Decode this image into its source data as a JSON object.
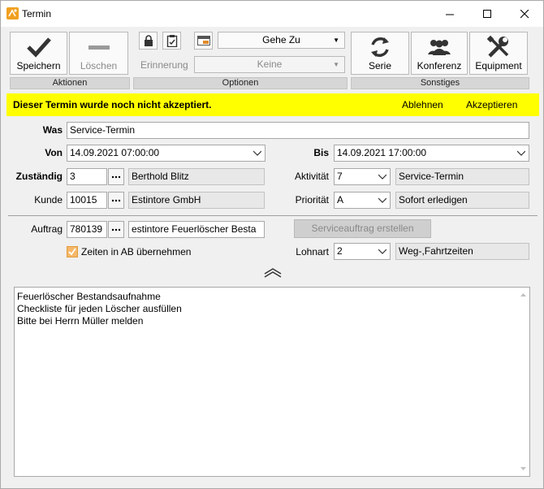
{
  "window": {
    "title": "Termin"
  },
  "toolbar": {
    "save_label": "Speichern",
    "delete_label": "Löschen",
    "goto_label": "Gehe Zu",
    "reminder_label": "Erinnerung",
    "reminder_value": "Keine",
    "series_label": "Serie",
    "conference_label": "Konferenz",
    "equipment_label": "Equipment",
    "group_actions": "Aktionen",
    "group_options": "Optionen",
    "group_misc": "Sonstiges"
  },
  "banner": {
    "message": "Dieser Termin wurde noch nicht akzeptiert.",
    "decline": "Ablehnen",
    "accept": "Akzeptieren",
    "color": "#ffff00"
  },
  "form": {
    "was_label": "Was",
    "was_value": "Service-Termin",
    "von_label": "Von",
    "von_value": "14.09.2021 07:00:00",
    "bis_label": "Bis",
    "bis_value": "14.09.2021 17:00:00",
    "zustaendig_label": "Zuständig",
    "zustaendig_id": "3",
    "zustaendig_name": "Berthold Blitz",
    "aktivitaet_label": "Aktivität",
    "aktivitaet_id": "7",
    "aktivitaet_name": "Service-Termin",
    "kunde_label": "Kunde",
    "kunde_id": "10015",
    "kunde_name": "Estintore GmbH",
    "prioritaet_label": "Priorität",
    "prioritaet_id": "A",
    "prioritaet_name": "Sofort erledigen",
    "auftrag_label": "Auftrag",
    "auftrag_id": "780139",
    "auftrag_name": "estintore Feuerlöscher Besta",
    "serviceauftrag_button": "Serviceauftrag erstellen",
    "zeiten_checkbox_label": "Zeiten in AB übernehmen",
    "lohnart_label": "Lohnart",
    "lohnart_id": "2",
    "lohnart_name": "Weg-,Fahrtzeiten"
  },
  "notes": {
    "lines": [
      "Feuerlöscher Bestandsaufnahme",
      "Checkliste für jeden Löscher ausfüllen",
      "Bitte bei Herrn Müller melden"
    ]
  }
}
